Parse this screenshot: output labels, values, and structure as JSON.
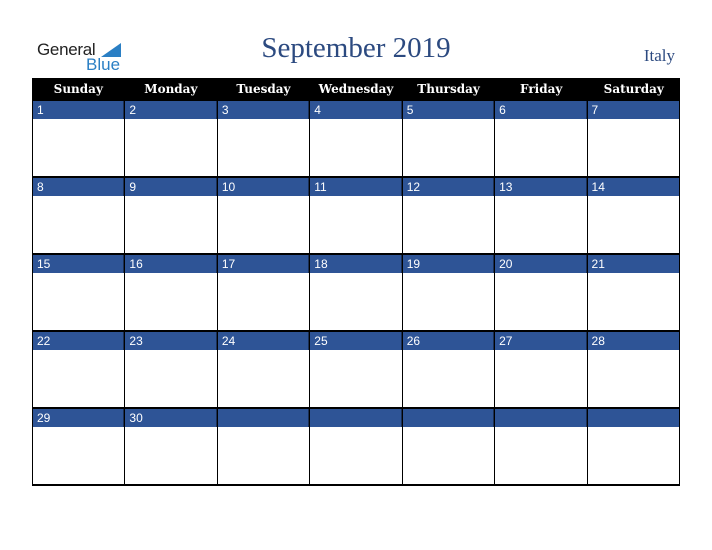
{
  "logo": {
    "line1": "General",
    "line2": "Blue"
  },
  "header": {
    "title": "September 2019",
    "country": "Italy"
  },
  "colors": {
    "band": "#2e5496",
    "header_bg": "#000000",
    "title": "#2c4a80",
    "logo_blue": "#2a7fc4"
  },
  "weekdays": [
    "Sunday",
    "Monday",
    "Tuesday",
    "Wednesday",
    "Thursday",
    "Friday",
    "Saturday"
  ],
  "weeks": [
    [
      "1",
      "2",
      "3",
      "4",
      "5",
      "6",
      "7"
    ],
    [
      "8",
      "9",
      "10",
      "11",
      "12",
      "13",
      "14"
    ],
    [
      "15",
      "16",
      "17",
      "18",
      "19",
      "20",
      "21"
    ],
    [
      "22",
      "23",
      "24",
      "25",
      "26",
      "27",
      "28"
    ],
    [
      "29",
      "30",
      "",
      "",
      "",
      "",
      ""
    ]
  ]
}
